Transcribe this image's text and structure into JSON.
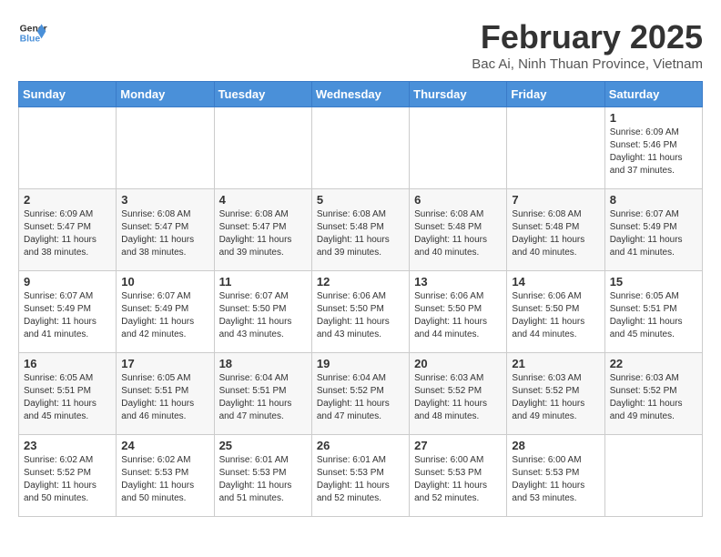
{
  "header": {
    "logo_line1": "General",
    "logo_line2": "Blue",
    "month_year": "February 2025",
    "location": "Bac Ai, Ninh Thuan Province, Vietnam"
  },
  "weekdays": [
    "Sunday",
    "Monday",
    "Tuesday",
    "Wednesday",
    "Thursday",
    "Friday",
    "Saturday"
  ],
  "weeks": [
    [
      {
        "day": "",
        "info": ""
      },
      {
        "day": "",
        "info": ""
      },
      {
        "day": "",
        "info": ""
      },
      {
        "day": "",
        "info": ""
      },
      {
        "day": "",
        "info": ""
      },
      {
        "day": "",
        "info": ""
      },
      {
        "day": "1",
        "info": "Sunrise: 6:09 AM\nSunset: 5:46 PM\nDaylight: 11 hours\nand 37 minutes."
      }
    ],
    [
      {
        "day": "2",
        "info": "Sunrise: 6:09 AM\nSunset: 5:47 PM\nDaylight: 11 hours\nand 38 minutes."
      },
      {
        "day": "3",
        "info": "Sunrise: 6:08 AM\nSunset: 5:47 PM\nDaylight: 11 hours\nand 38 minutes."
      },
      {
        "day": "4",
        "info": "Sunrise: 6:08 AM\nSunset: 5:47 PM\nDaylight: 11 hours\nand 39 minutes."
      },
      {
        "day": "5",
        "info": "Sunrise: 6:08 AM\nSunset: 5:48 PM\nDaylight: 11 hours\nand 39 minutes."
      },
      {
        "day": "6",
        "info": "Sunrise: 6:08 AM\nSunset: 5:48 PM\nDaylight: 11 hours\nand 40 minutes."
      },
      {
        "day": "7",
        "info": "Sunrise: 6:08 AM\nSunset: 5:48 PM\nDaylight: 11 hours\nand 40 minutes."
      },
      {
        "day": "8",
        "info": "Sunrise: 6:07 AM\nSunset: 5:49 PM\nDaylight: 11 hours\nand 41 minutes."
      }
    ],
    [
      {
        "day": "9",
        "info": "Sunrise: 6:07 AM\nSunset: 5:49 PM\nDaylight: 11 hours\nand 41 minutes."
      },
      {
        "day": "10",
        "info": "Sunrise: 6:07 AM\nSunset: 5:49 PM\nDaylight: 11 hours\nand 42 minutes."
      },
      {
        "day": "11",
        "info": "Sunrise: 6:07 AM\nSunset: 5:50 PM\nDaylight: 11 hours\nand 43 minutes."
      },
      {
        "day": "12",
        "info": "Sunrise: 6:06 AM\nSunset: 5:50 PM\nDaylight: 11 hours\nand 43 minutes."
      },
      {
        "day": "13",
        "info": "Sunrise: 6:06 AM\nSunset: 5:50 PM\nDaylight: 11 hours\nand 44 minutes."
      },
      {
        "day": "14",
        "info": "Sunrise: 6:06 AM\nSunset: 5:50 PM\nDaylight: 11 hours\nand 44 minutes."
      },
      {
        "day": "15",
        "info": "Sunrise: 6:05 AM\nSunset: 5:51 PM\nDaylight: 11 hours\nand 45 minutes."
      }
    ],
    [
      {
        "day": "16",
        "info": "Sunrise: 6:05 AM\nSunset: 5:51 PM\nDaylight: 11 hours\nand 45 minutes."
      },
      {
        "day": "17",
        "info": "Sunrise: 6:05 AM\nSunset: 5:51 PM\nDaylight: 11 hours\nand 46 minutes."
      },
      {
        "day": "18",
        "info": "Sunrise: 6:04 AM\nSunset: 5:51 PM\nDaylight: 11 hours\nand 47 minutes."
      },
      {
        "day": "19",
        "info": "Sunrise: 6:04 AM\nSunset: 5:52 PM\nDaylight: 11 hours\nand 47 minutes."
      },
      {
        "day": "20",
        "info": "Sunrise: 6:03 AM\nSunset: 5:52 PM\nDaylight: 11 hours\nand 48 minutes."
      },
      {
        "day": "21",
        "info": "Sunrise: 6:03 AM\nSunset: 5:52 PM\nDaylight: 11 hours\nand 49 minutes."
      },
      {
        "day": "22",
        "info": "Sunrise: 6:03 AM\nSunset: 5:52 PM\nDaylight: 11 hours\nand 49 minutes."
      }
    ],
    [
      {
        "day": "23",
        "info": "Sunrise: 6:02 AM\nSunset: 5:52 PM\nDaylight: 11 hours\nand 50 minutes."
      },
      {
        "day": "24",
        "info": "Sunrise: 6:02 AM\nSunset: 5:53 PM\nDaylight: 11 hours\nand 50 minutes."
      },
      {
        "day": "25",
        "info": "Sunrise: 6:01 AM\nSunset: 5:53 PM\nDaylight: 11 hours\nand 51 minutes."
      },
      {
        "day": "26",
        "info": "Sunrise: 6:01 AM\nSunset: 5:53 PM\nDaylight: 11 hours\nand 52 minutes."
      },
      {
        "day": "27",
        "info": "Sunrise: 6:00 AM\nSunset: 5:53 PM\nDaylight: 11 hours\nand 52 minutes."
      },
      {
        "day": "28",
        "info": "Sunrise: 6:00 AM\nSunset: 5:53 PM\nDaylight: 11 hours\nand 53 minutes."
      },
      {
        "day": "",
        "info": ""
      }
    ]
  ]
}
